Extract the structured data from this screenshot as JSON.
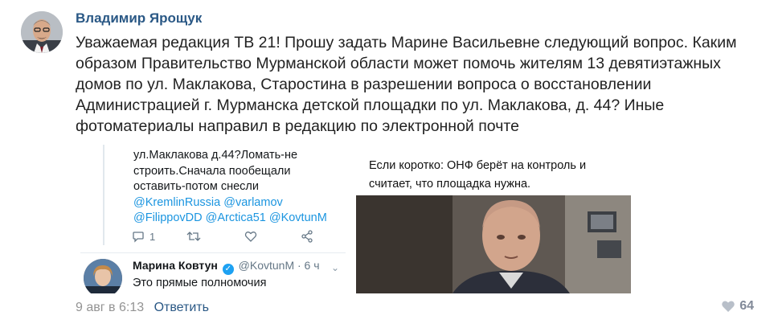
{
  "post": {
    "author": "Владимир Ярощук",
    "text": "Уважаемая редакция ТВ 21! Прошу задать Марине Васильевне следующий вопрос. Каким образом Правительство Мурманской области может помочь жителям 13 девятиэтажных домов по ул. Маклакова, Старостина в разрешении вопроса о восстановлении Администрацией г. Мурманска детской площадки по ул. Маклакова, д. 44? Иные фотоматериалы направил в редакцию по электронной почте",
    "date": "9 авг в 6:13",
    "reply_label": "Ответить",
    "likes": "64"
  },
  "tweet": {
    "lines": [
      "ул.Маклакова д.44?Ломать-не",
      "строить.Сначала пообещали",
      "оставить-потом снесли"
    ],
    "mentions": [
      "@KremlinRussia @varlamov",
      "@FilippovDD @Arctica51 @KovtunM"
    ],
    "reply_count": "1",
    "reply": {
      "name": "Марина Ковтун",
      "handle": "@KovtunM · 6 ч",
      "text": "Это прямые полномочия"
    }
  },
  "video": {
    "caption": "Если коротко: ОНФ берёт на контроль и считает, что площадка нужна."
  },
  "colors": {
    "link": "#2a5885",
    "meta": "#939393",
    "twitter_blue": "#1b95e0"
  }
}
